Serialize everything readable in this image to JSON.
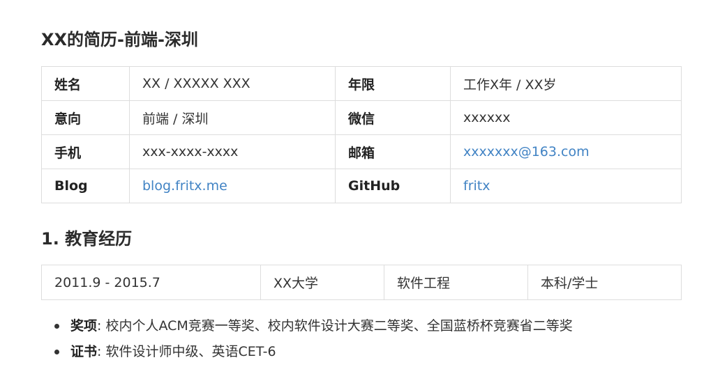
{
  "header": {
    "title": "XX的简历-前端-深圳"
  },
  "info": {
    "rows": [
      {
        "l1": "姓名",
        "v1": "XX / XXXXX XXX",
        "l2": "年限",
        "v2": "工作X年 / XX岁"
      },
      {
        "l1": "意向",
        "v1": "前端 / 深圳",
        "l2": "微信",
        "v2": "xxxxxx"
      },
      {
        "l1": "手机",
        "v1": "xxx-xxxx-xxxx",
        "l2": "邮箱",
        "v2": "xxxxxxx@163.com"
      },
      {
        "l1": "Blog",
        "v1": "blog.fritx.me",
        "l2": "GitHub",
        "v2": "fritx"
      }
    ]
  },
  "education": {
    "section_title": "1. 教育经历",
    "period": "2011.9 - 2015.7",
    "school": "XX大学",
    "major": "软件工程",
    "degree": "本科/学士"
  },
  "bullets": [
    {
      "label": "奖项",
      "sep": ":",
      "text": "校内个人ACM竞赛一等奖、校内软件设计大赛二等奖、全国蓝桥杯竞赛省二等奖"
    },
    {
      "label": "证书",
      "sep": ":",
      "text": "软件设计师中级、英语CET-6"
    }
  ],
  "colors": {
    "link": "#4183c4",
    "border": "#dddddd",
    "text": "#333333"
  }
}
